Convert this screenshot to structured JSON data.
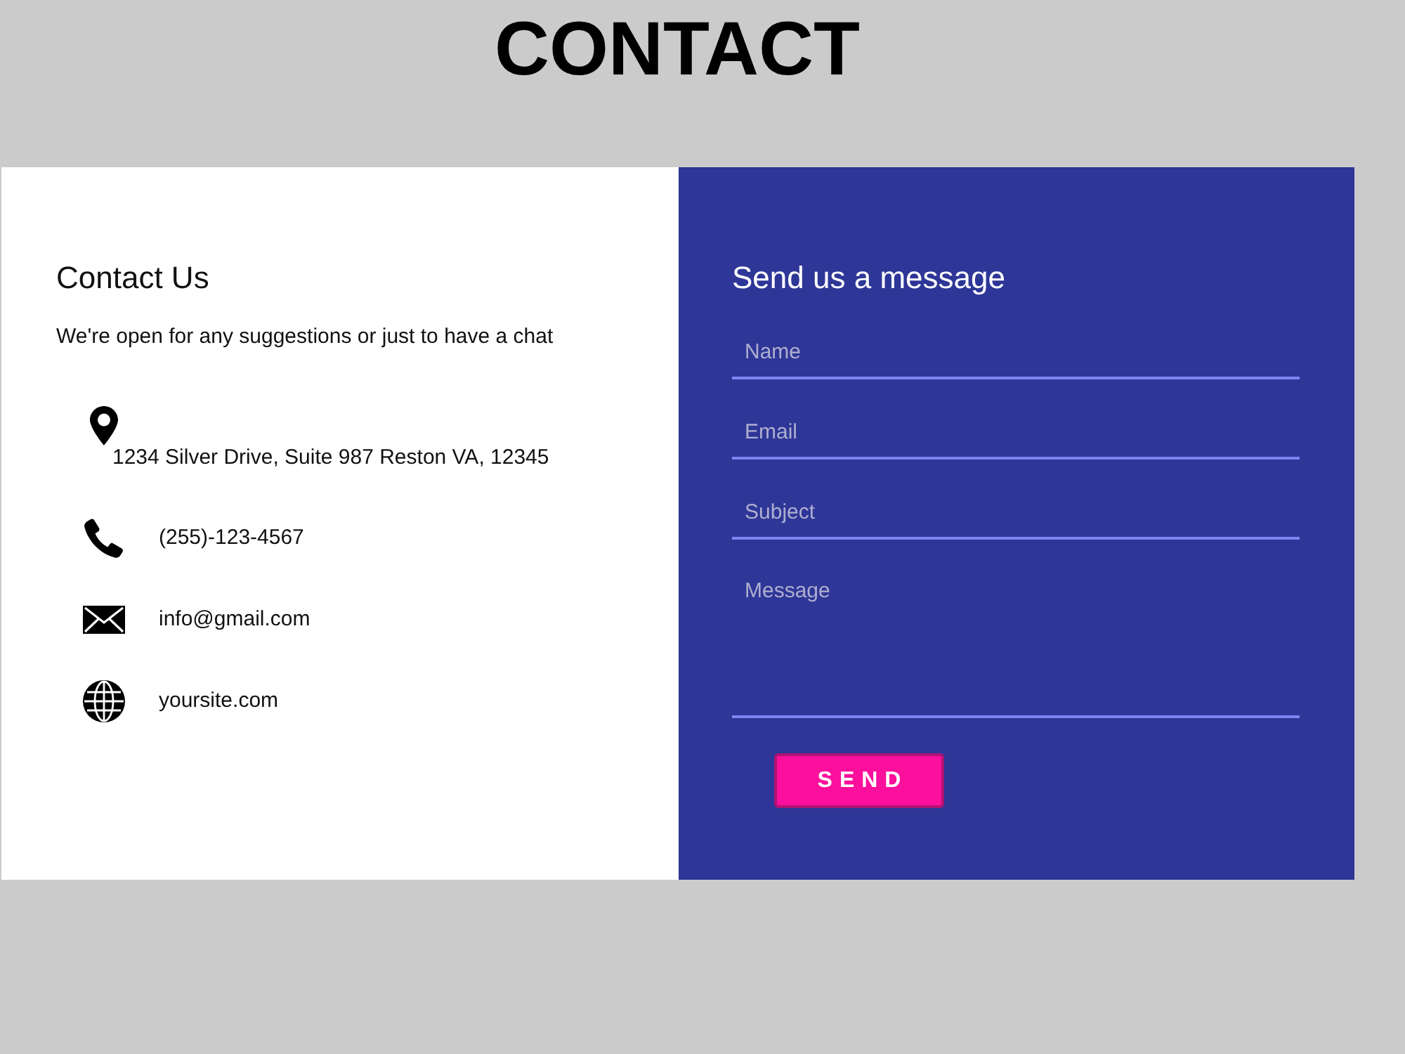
{
  "page_title": "CONTACT",
  "contact_info": {
    "title": "Contact Us",
    "subtitle": "We're open for any suggestions or just to have a chat",
    "items": [
      {
        "kind": "address",
        "text": "1234 Silver Drive, Suite 987 Reston VA, 12345"
      },
      {
        "kind": "phone",
        "text": "(255)-123-4567"
      },
      {
        "kind": "email",
        "text": "info@gmail.com"
      },
      {
        "kind": "website",
        "text": "yoursite.com"
      }
    ]
  },
  "form": {
    "title": "Send us a message",
    "fields": [
      {
        "kind": "input",
        "placeholder": "Name"
      },
      {
        "kind": "input",
        "placeholder": "Email"
      },
      {
        "kind": "input",
        "placeholder": "Subject"
      },
      {
        "kind": "textarea",
        "placeholder": "Message"
      }
    ],
    "submit_button": "SEND"
  }
}
